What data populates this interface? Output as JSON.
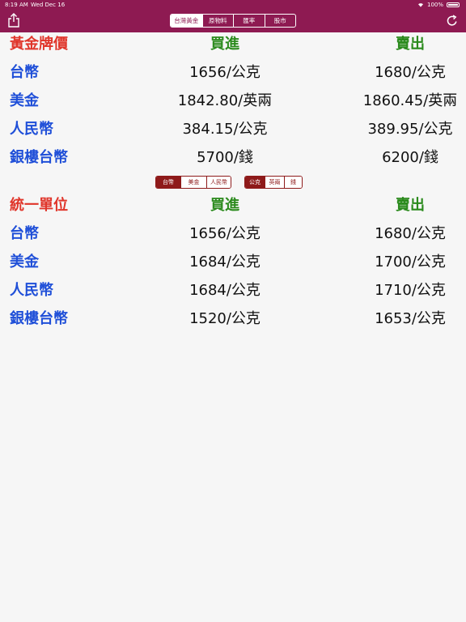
{
  "status_bar": {
    "time": "8:19 AM",
    "date": "Wed Dec 16",
    "battery": "100%"
  },
  "top_tabs": [
    "台灣黃金",
    "原物料",
    "匯率",
    "股市"
  ],
  "table1": {
    "header": [
      "黃金牌價",
      "買進",
      "賣出"
    ],
    "rows": [
      [
        "台幣",
        "1656/公克",
        "1680/公克"
      ],
      [
        "美金",
        "1842.80/英兩",
        "1860.45/英兩"
      ],
      [
        "人民幣",
        "384.15/公克",
        "389.95/公克"
      ],
      [
        "銀樓台幣",
        "5700/錢",
        "6200/錢"
      ]
    ]
  },
  "currency_seg": [
    "台幣",
    "美金",
    "人民幣"
  ],
  "unit_seg": [
    "公克",
    "英兩",
    "錢"
  ],
  "table2": {
    "header": [
      "統一單位",
      "買進",
      "賣出"
    ],
    "rows": [
      [
        "台幣",
        "1656/公克",
        "1680/公克"
      ],
      [
        "美金",
        "1684/公克",
        "1700/公克"
      ],
      [
        "人民幣",
        "1684/公克",
        "1710/公克"
      ],
      [
        "銀樓台幣",
        "1520/公克",
        "1653/公克"
      ]
    ]
  },
  "colors": {
    "bar": "#8e1a52",
    "header_red": "#e0352a",
    "header_green": "#2a8a1c",
    "label_blue": "#1f4fd8"
  }
}
